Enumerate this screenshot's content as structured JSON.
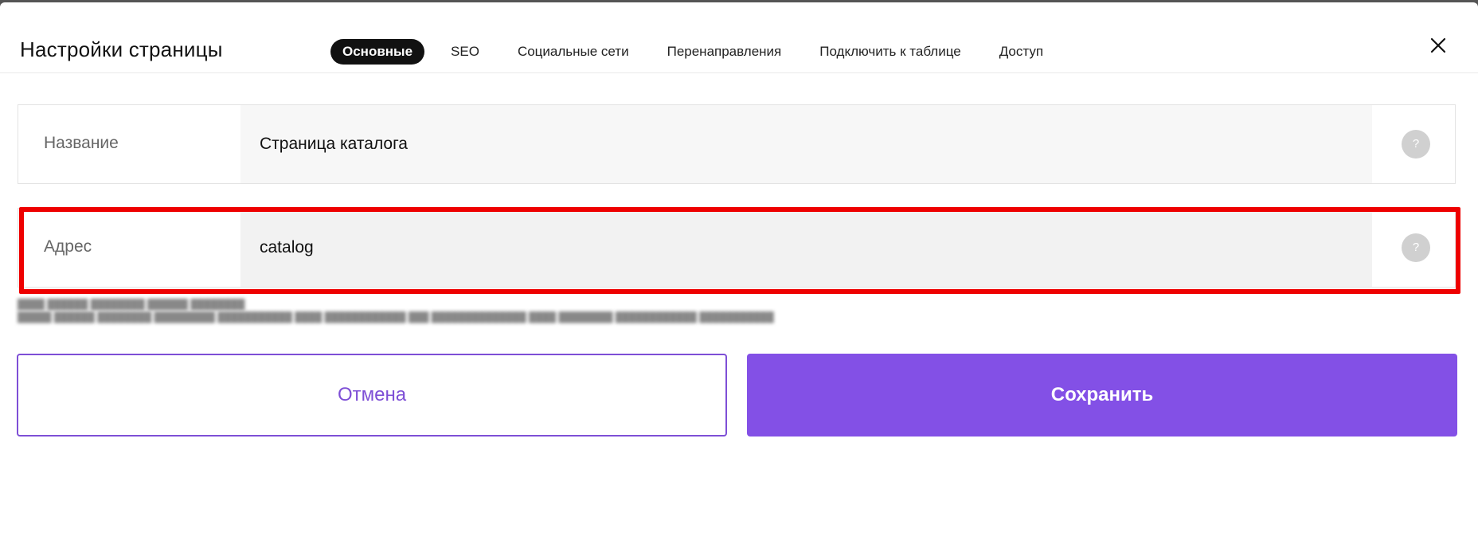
{
  "dialog": {
    "title": "Настройки страницы",
    "close_icon": "close-icon"
  },
  "tabs": [
    {
      "label": "Основные",
      "active": true
    },
    {
      "label": "SEO",
      "active": false
    },
    {
      "label": "Социальные сети",
      "active": false
    },
    {
      "label": "Перенаправления",
      "active": false
    },
    {
      "label": "Подключить к таблице",
      "active": false
    },
    {
      "label": "Доступ",
      "active": false
    }
  ],
  "fields": {
    "name": {
      "label": "Название",
      "value": "Страница каталога",
      "help": "?"
    },
    "address": {
      "label": "Адрес",
      "value": "catalog",
      "help": "?"
    }
  },
  "buttons": {
    "cancel": "Отмена",
    "save": "Сохранить"
  },
  "colors": {
    "accent": "#8350e6",
    "highlight": "#ee0000",
    "active_tab": "#111111"
  }
}
